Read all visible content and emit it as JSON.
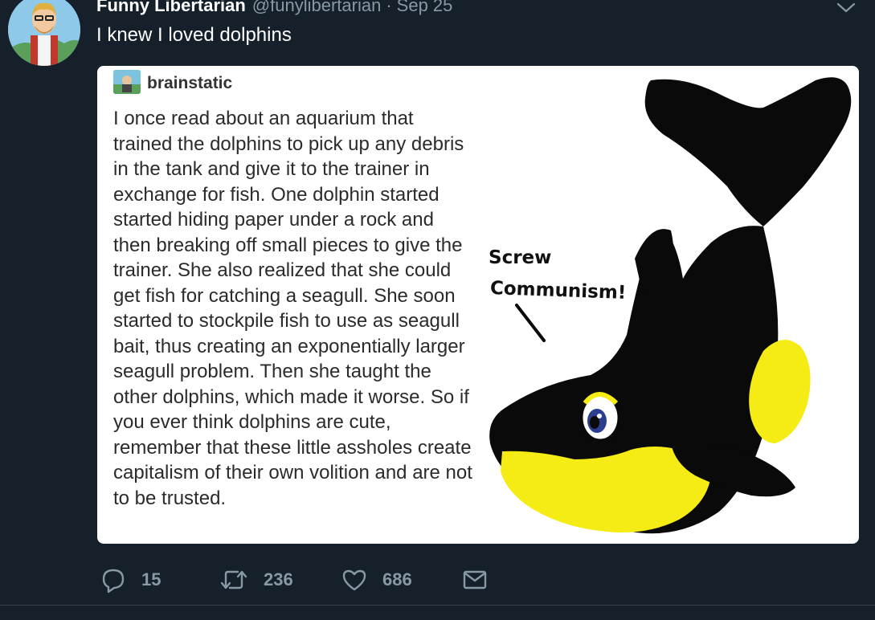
{
  "tweet": {
    "display_name": "Funny Libertarian",
    "handle": "@funylibertarian",
    "separator": "·",
    "timestamp": "Sep 25",
    "text": "I knew I loved dolphins"
  },
  "card": {
    "tumblr_user": "brainstatic",
    "post_text": "I once read about an aquarium that trained the dolphins to pick up any debris in the tank and give it to the trainer in exchange for fish. One dolphin started started hiding paper under a rock and then breaking off small pieces to give the trainer. She also realized that she could get fish for catching a seagull. She soon started to stockpile fish to use as seagull bait, thus creating an exponentially larger seagull problem. Then she taught the other dolphins, which made it worse. So if you ever think dolphins are cute, remember that these little assholes create capitalism of their own volition and are not to be trusted.",
    "speech_line1": "Screw",
    "speech_line2": "Communism!"
  },
  "actions": {
    "reply_count": "15",
    "retweet_count": "236",
    "like_count": "686"
  },
  "icons": {
    "reply": "reply-icon",
    "retweet": "retweet-icon",
    "like": "heart-icon",
    "share": "share-icon",
    "caret": "chevron-down-icon"
  },
  "colors": {
    "background": "#15202b",
    "secondary_text": "#8899a6",
    "orca_black": "#0a0a0a",
    "orca_yellow": "#f4ec14"
  }
}
